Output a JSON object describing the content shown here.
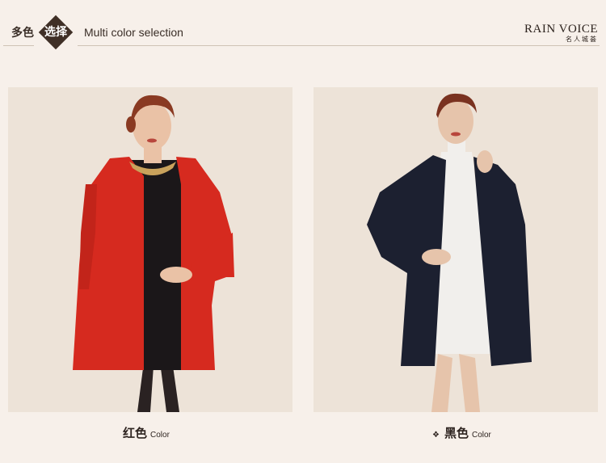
{
  "header": {
    "section_cn_prefix": "多色",
    "section_cn_badge": "选择",
    "section_en": "Multi color selection",
    "brand_name": "RAIN VOICE",
    "brand_sub": "名人城荟"
  },
  "products": [
    {
      "color_cn": "红色",
      "color_en": "Color",
      "coat_color": "#d62a1f",
      "selected": false
    },
    {
      "color_cn": "黑色",
      "color_en": "Color",
      "coat_color": "#1c2030",
      "selected": true,
      "marker": "❖"
    }
  ],
  "colors": {
    "background": "#f7f0ea",
    "accent": "#3f2f26",
    "photo_bg": "#ede3d8"
  }
}
